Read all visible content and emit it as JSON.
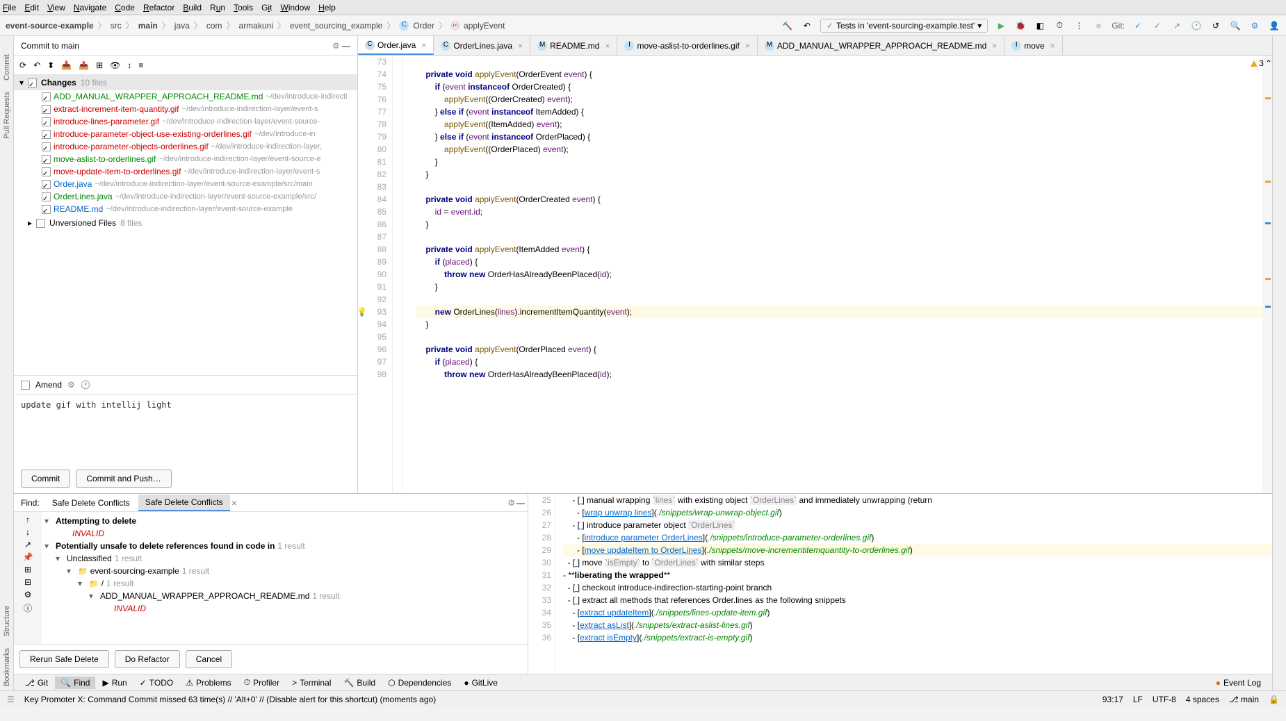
{
  "menubar": [
    "File",
    "Edit",
    "View",
    "Navigate",
    "Code",
    "Refactor",
    "Build",
    "Run",
    "Tools",
    "Git",
    "Window",
    "Help"
  ],
  "breadcrumb": {
    "segments": [
      "event-source-example",
      "src",
      "main",
      "java",
      "com",
      "armakuni",
      "event_sourcing_example",
      "Order",
      "applyEvent"
    ]
  },
  "run_config": "Tests in 'event-sourcing-example.test'",
  "git_label": "Git:",
  "commit": {
    "title": "Commit to main",
    "changes_label": "Changes",
    "changes_count": "10 files",
    "files": [
      {
        "name": "ADD_MANUAL_WRAPPER_APPROACH_README.md",
        "path": "~/dev/introduce-indirecti",
        "color": "green"
      },
      {
        "name": "extract-increment-item-quantity.gif",
        "path": "~/dev/introduce-indirection-layer/event-s",
        "color": "red"
      },
      {
        "name": "introduce-lines-parameter.gif",
        "path": "~/dev/introduce-indirection-layer/event-source-",
        "color": "red"
      },
      {
        "name": "introduce-parameter-object-use-existing-orderlines.gif",
        "path": "~/dev/introduce-in",
        "color": "red"
      },
      {
        "name": "introduce-parameter-objects-orderlines.gif",
        "path": "~/dev/introduce-indirection-layer,",
        "color": "red"
      },
      {
        "name": "move-aslist-to-orderlines.gif",
        "path": "~/dev/introduce-indirection-layer/event-source-e",
        "color": "green"
      },
      {
        "name": "move-update-item-to-orderlines.gif",
        "path": "~/dev/introduce-indirection-layer/event-s",
        "color": "red"
      },
      {
        "name": "Order.java",
        "path": "~/dev/introduce-indirection-layer/event-source-example/src/main",
        "color": "blue"
      },
      {
        "name": "OrderLines.java",
        "path": "~/dev/introduce-indirection-layer/event-source-example/src/",
        "color": "green"
      },
      {
        "name": "README.md",
        "path": "~/dev/introduce-indirection-layer/event-source-example",
        "color": "blue"
      }
    ],
    "unversioned_label": "Unversioned Files",
    "unversioned_count": "8 files",
    "amend_label": "Amend",
    "message": "update gif with intellij light",
    "commit_btn": "Commit",
    "commit_push_btn": "Commit and Push…"
  },
  "editor_tabs": [
    {
      "label": "Order.java",
      "active": true,
      "icon": "C"
    },
    {
      "label": "OrderLines.java",
      "active": false,
      "icon": "C"
    },
    {
      "label": "README.md",
      "active": false,
      "icon": "M"
    },
    {
      "label": "move-aslist-to-orderlines.gif",
      "active": false,
      "icon": "I"
    },
    {
      "label": "ADD_MANUAL_WRAPPER_APPROACH_README.md",
      "active": false,
      "icon": "M"
    },
    {
      "label": "move",
      "active": false,
      "icon": "I"
    }
  ],
  "warnings": "3",
  "code_lines": [
    {
      "n": 73,
      "t": ""
    },
    {
      "n": 74,
      "t": "    private void applyEvent(OrderEvent event) {"
    },
    {
      "n": 75,
      "t": "        if (event instanceof OrderCreated) {"
    },
    {
      "n": 76,
      "t": "            applyEvent((OrderCreated) event);"
    },
    {
      "n": 77,
      "t": "        } else if (event instanceof ItemAdded) {"
    },
    {
      "n": 78,
      "t": "            applyEvent((ItemAdded) event);"
    },
    {
      "n": 79,
      "t": "        } else if (event instanceof OrderPlaced) {"
    },
    {
      "n": 80,
      "t": "            applyEvent((OrderPlaced) event);"
    },
    {
      "n": 81,
      "t": "        }"
    },
    {
      "n": 82,
      "t": "    }"
    },
    {
      "n": 83,
      "t": ""
    },
    {
      "n": 84,
      "t": "    private void applyEvent(OrderCreated event) {"
    },
    {
      "n": 85,
      "t": "        id = event.id;"
    },
    {
      "n": 86,
      "t": "    }"
    },
    {
      "n": 87,
      "t": ""
    },
    {
      "n": 88,
      "t": "    private void applyEvent(ItemAdded event) {"
    },
    {
      "n": 89,
      "t": "        if (placed) {"
    },
    {
      "n": 90,
      "t": "            throw new OrderHasAlreadyBeenPlaced(id);"
    },
    {
      "n": 91,
      "t": "        }"
    },
    {
      "n": 92,
      "t": ""
    },
    {
      "n": 93,
      "t": "        new OrderLines(lines).incrementItemQuantity(event);",
      "cursor": true
    },
    {
      "n": 94,
      "t": "    }"
    },
    {
      "n": 95,
      "t": ""
    },
    {
      "n": 96,
      "t": "    private void applyEvent(OrderPlaced event) {"
    },
    {
      "n": 97,
      "t": "        if (placed) {"
    },
    {
      "n": 98,
      "t": "            throw new OrderHasAlreadyBeenPlaced(id);"
    }
  ],
  "find": {
    "label": "Find:",
    "tabs": [
      "Safe Delete Conflicts",
      "Safe Delete Conflicts"
    ],
    "tree": {
      "root1": "Attempting to delete",
      "invalid1": "INVALID",
      "root2": "Potentially unsafe to delete references found in code in",
      "root2_count": "1 result",
      "l1": "Unclassified",
      "l1_count": "1 result",
      "l2": "event-sourcing-example",
      "l2_count": "1 result",
      "l3": "/",
      "l3_count": "1 result",
      "l4": "ADD_MANUAL_WRAPPER_APPROACH_README.md",
      "l4_count": "1 result",
      "invalid2": "INVALID"
    },
    "btns": [
      "Rerun Safe Delete",
      "Do Refactor",
      "Cancel"
    ]
  },
  "md_lines": [
    {
      "n": 25,
      "t": "    - [ ] manual wrapping `lines` with existing object `OrderLines` and immediately unwrapping (return"
    },
    {
      "n": 26,
      "t": "      - [wrap unwrap lines](./snippets/wrap-unwrap-object.gif)"
    },
    {
      "n": 27,
      "t": "    - [ ] introduce parameter object `OrderLines`"
    },
    {
      "n": 28,
      "t": "      - [introduce parameter OrderLines](./snippets/introduce-parameter-orderlines.gif)"
    },
    {
      "n": 29,
      "t": "      - [move updateItem to OrderLines](./snippets/move-incrementitemquantity-to-orderlines.gif)",
      "cursor": true
    },
    {
      "n": 30,
      "t": "  - [ ] move `isEmpty` to `OrderLines` with similar steps"
    },
    {
      "n": 31,
      "t": "- **liberating the wrapped**"
    },
    {
      "n": 32,
      "t": "  - [ ] checkout introduce-indirection-starting-point branch"
    },
    {
      "n": 33,
      "t": "  - [ ] extract all methods that references Order.lines as the following snippets"
    },
    {
      "n": 34,
      "t": "    - [extract updateItem](./snippets/lines-update-item.gif)"
    },
    {
      "n": 35,
      "t": "    - [extract asList](./snippets/extract-aslist-lines.gif)"
    },
    {
      "n": 36,
      "t": "    - [extract isEmpty](./snippets/extract-is-empty.gif)"
    }
  ],
  "bottom_tools": [
    {
      "label": "Git",
      "icon": "⎇"
    },
    {
      "label": "Find",
      "icon": "🔍",
      "selected": true
    },
    {
      "label": "Run",
      "icon": "▶"
    },
    {
      "label": "TODO",
      "icon": "✓"
    },
    {
      "label": "Problems",
      "icon": "⚠"
    },
    {
      "label": "Profiler",
      "icon": "⏱"
    },
    {
      "label": "Terminal",
      "icon": ">"
    },
    {
      "label": "Build",
      "icon": "🔨"
    },
    {
      "label": "Dependencies",
      "icon": "⬡"
    },
    {
      "label": "GitLive",
      "icon": "●"
    }
  ],
  "event_log": "Event Log",
  "status": {
    "msg": "Key Promoter X: Command Commit missed 63 time(s) // 'Alt+0' // (Disable alert for this shortcut) (moments ago)",
    "pos": "93:17",
    "sep": "LF",
    "enc": "UTF-8",
    "indent": "4 spaces",
    "branch": "main"
  },
  "left_tools": [
    "Commit",
    "Pull Requests"
  ],
  "left_tools2": [
    "Structure",
    "Bookmarks"
  ]
}
